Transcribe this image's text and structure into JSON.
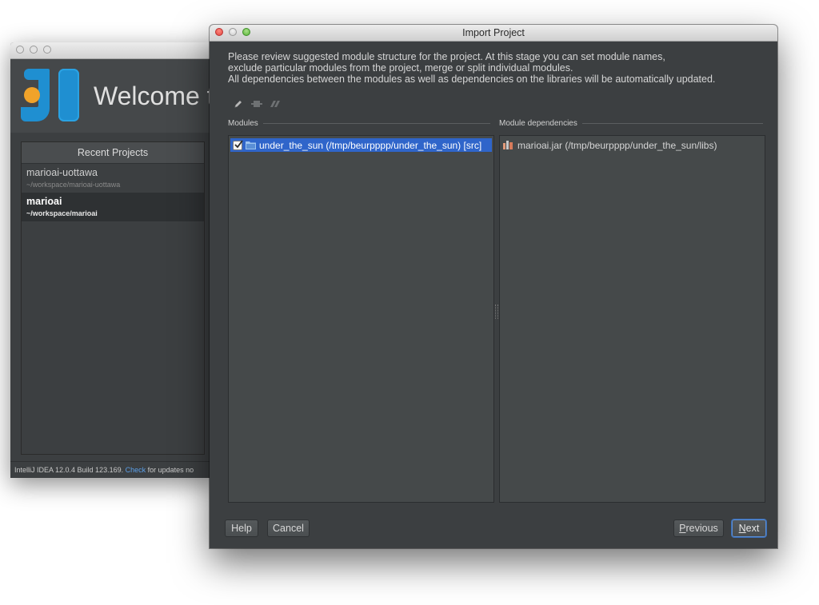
{
  "welcome_window": {
    "title_fragment": "Welcome t",
    "recent_projects": {
      "header": "Recent Projects",
      "items": [
        {
          "name": "marioai-uottawa",
          "path": "~/workspace/marioai-uottawa",
          "selected": false
        },
        {
          "name": "marioai",
          "path": "~/workspace/marioai",
          "selected": true
        }
      ]
    },
    "status": {
      "prefix": "IntelliJ IDEA 12.0.4 Build 123.169.",
      "link": "Check",
      "suffix": " for updates no"
    }
  },
  "dialog": {
    "title": "Import Project",
    "intro_lines": [
      "Please review suggested module structure for the project. At this stage you can set module names,",
      "exclude particular modules from the project, merge or split individual modules.",
      "All dependencies between the modules as well as dependencies on the libraries will be automatically updated."
    ],
    "toolbar_icons": [
      "pencil-icon",
      "split-icon",
      "merge-icon"
    ],
    "modules_label": "Modules",
    "dependencies_label": "Module dependencies",
    "modules": [
      {
        "label": "under_the_sun (/tmp/beurpppp/under_the_sun) [src]",
        "checked": true,
        "selected": true
      }
    ],
    "dependencies": [
      {
        "label": "marioai.jar (/tmp/beurpppp/under_the_sun/libs)"
      }
    ],
    "buttons": {
      "help": "Help",
      "cancel": "Cancel",
      "previous_mnemonic": "P",
      "previous_rest": "revious",
      "next_mnemonic": "N",
      "next_rest": "ext"
    }
  },
  "colors": {
    "dialog_bg": "#3c3f41",
    "selection": "#2f65ca",
    "link": "#5b9fe8",
    "logo_orange": "#f0a32a",
    "logo_blue": "#1f8fd1"
  }
}
